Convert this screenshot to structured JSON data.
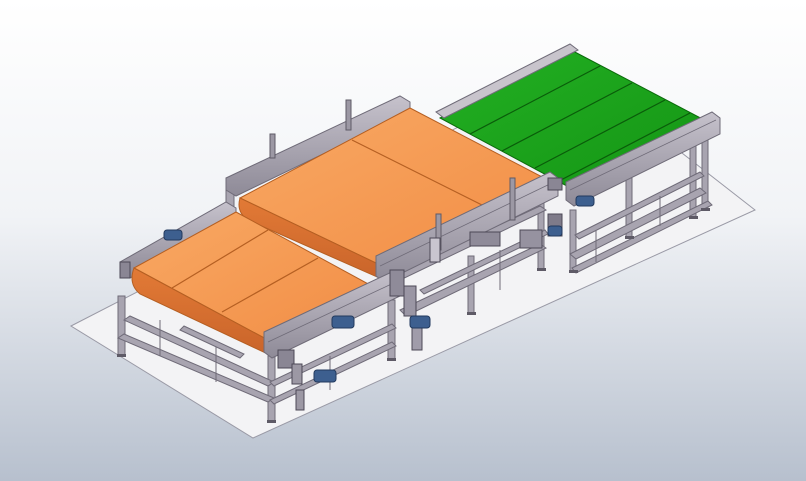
{
  "viewport": {
    "background_top": "#ffffff",
    "background_bottom": "#b7c0ce"
  },
  "model": {
    "frame_color": "#a8a4b0",
    "frame_dark": "#6f6b78",
    "orange_belt_color": "#f79d58",
    "green_belt_color": "#1ea51e",
    "motor_color": "#3d5f8f",
    "floor_color": "#f2f2f4"
  }
}
